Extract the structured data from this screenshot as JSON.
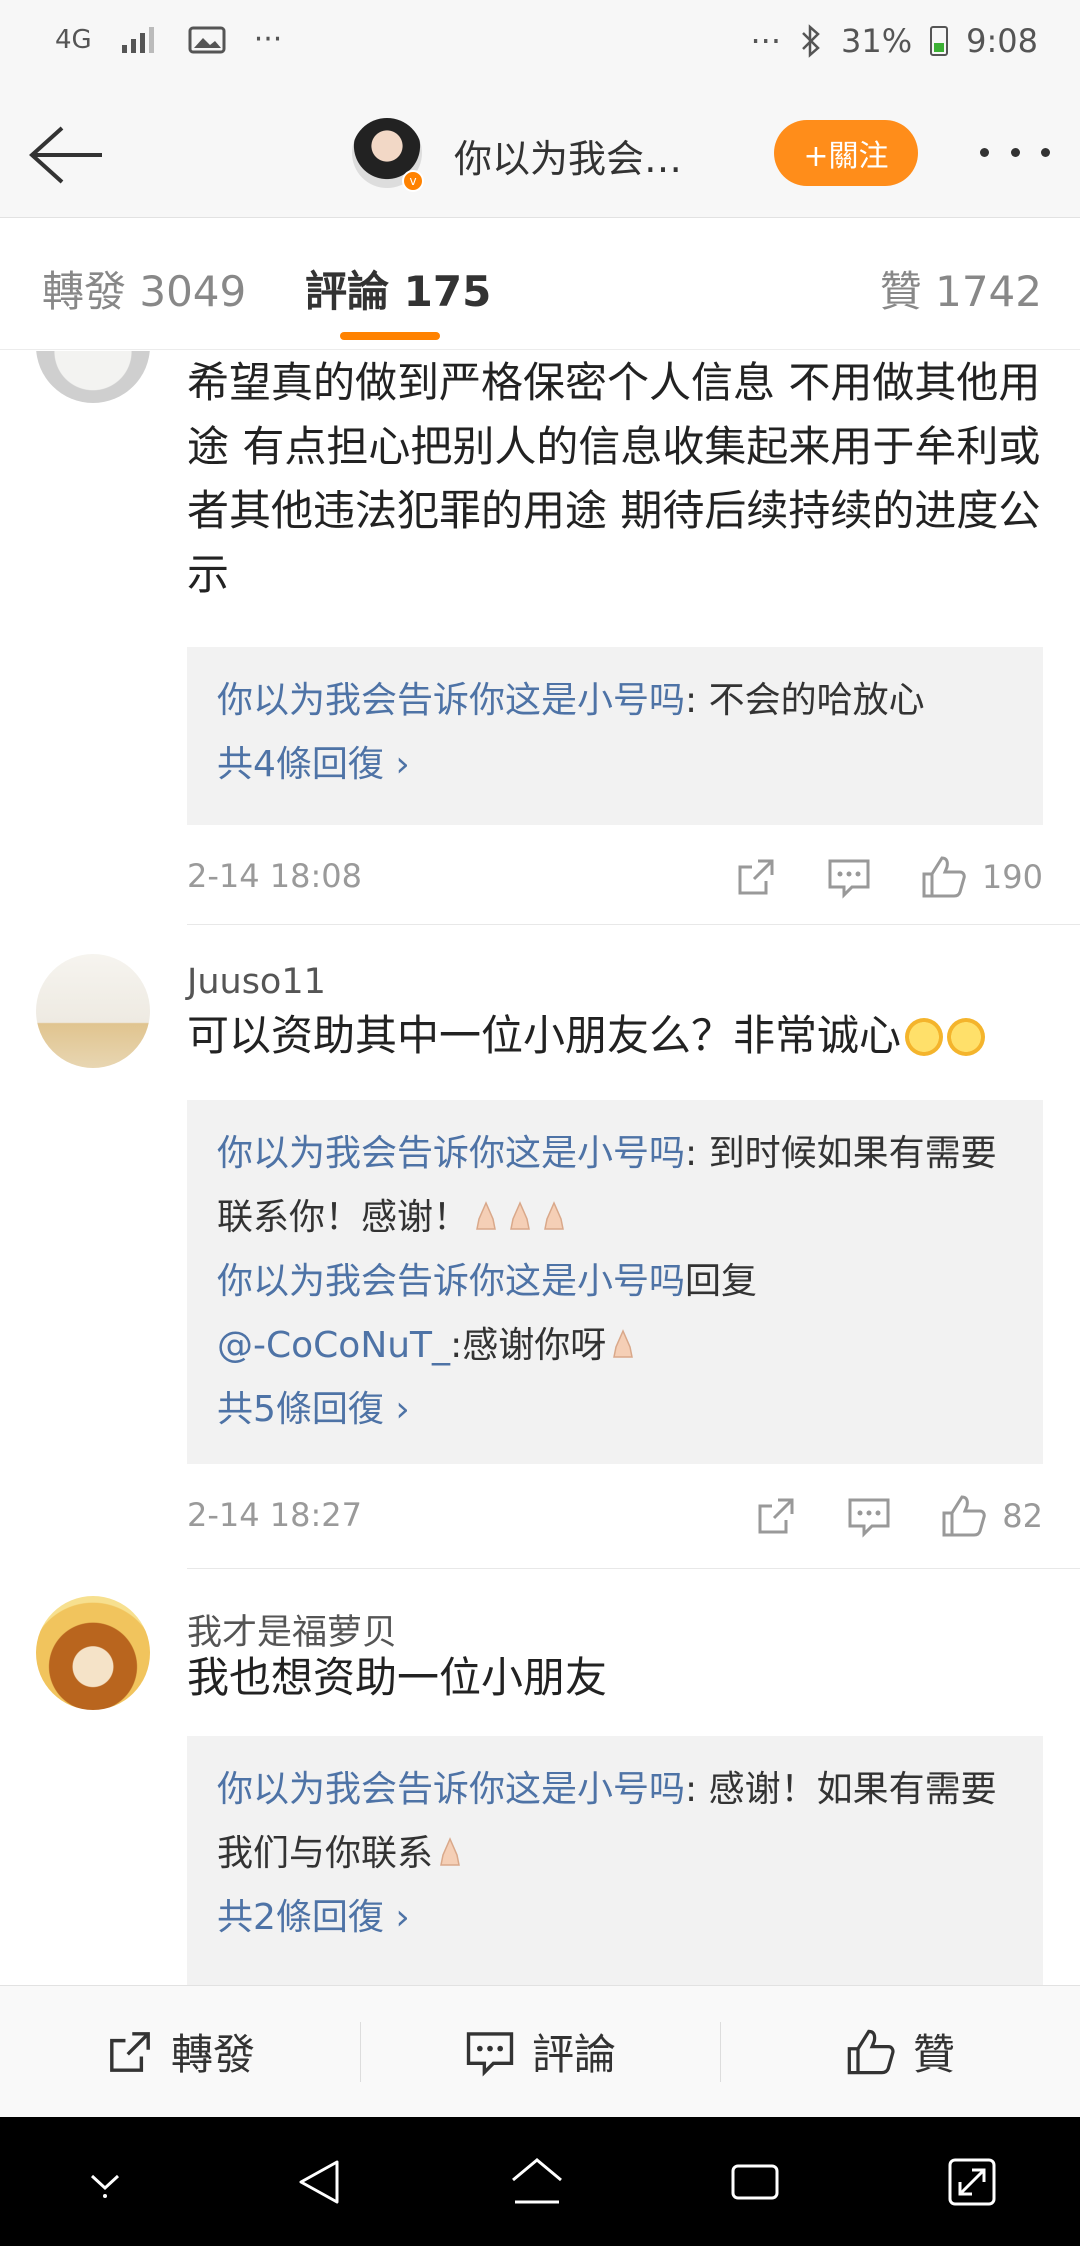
{
  "status_bar": {
    "network": "4G",
    "more_left": "···",
    "more_right": "···",
    "battery": "31%",
    "time": "9:08"
  },
  "header": {
    "title": "你以为我会告…",
    "follow_label": "+關注"
  },
  "tabs": [
    {
      "label": "轉發 3049"
    },
    {
      "label": "評論 175"
    },
    {
      "label": "贊 1742"
    }
  ],
  "comments": [
    {
      "username": "",
      "text": "希望真的做到严格保密个人信息 不用做其他用途 有点担心把别人的信息收集起来用于牟利或者其他违法犯罪的用途 期待后续持续的进度公示",
      "replies": [
        {
          "user": "你以为我会告诉你这是小号吗",
          "text": ": 不会的哈放心"
        }
      ],
      "more_replies": "共4條回復 ›",
      "time": "2-14 18:08",
      "likes": "190"
    },
    {
      "username": "Juuso11",
      "text": "可以资助其中一位小朋友么？非常诚心",
      "replies": [
        {
          "user": "你以为我会告诉你这是小号吗",
          "text": ": 到时候如果有需要联系你！感谢！"
        },
        {
          "user": "你以为我会告诉你这是小号吗",
          "text": "回复",
          "mention": "@-CoCoNuT_",
          "text2": ":感谢你呀"
        }
      ],
      "more_replies": "共5條回復 ›",
      "time": "2-14 18:27",
      "likes": "82"
    },
    {
      "username": "我才是福萝贝",
      "text": "我也想资助一位小朋友",
      "replies": [
        {
          "user": "你以为我会告诉你这是小号吗",
          "text": ": 感谢！如果有需要我们与你联系"
        }
      ],
      "more_replies": "共2條回復 ›"
    }
  ],
  "action_bar": {
    "repost": "轉發",
    "comment": "評論",
    "like": "贊"
  },
  "colors": {
    "accent": "#ff8200",
    "link": "#4e73a6",
    "reply_bg": "#f2f2f2"
  }
}
